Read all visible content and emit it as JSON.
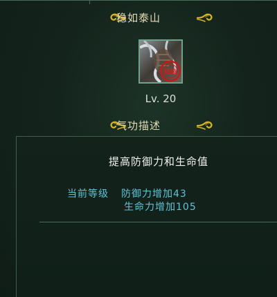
{
  "skill": {
    "name": "稳如泰山",
    "level": "Lv. 20",
    "icon": "skill-stone-armor-icon",
    "stamp_text": "顶级"
  },
  "description_header": "气功描述",
  "description": {
    "main": "提高防御力和生命值",
    "current_level_label": "当前等级",
    "bonuses": [
      "防御力增加43",
      "生命力增加105"
    ]
  },
  "colors": {
    "title": "#e4dbb5",
    "ornament": "#d8b62a",
    "bonus_text": "#5fc4d8",
    "body_text": "#f2f2f2",
    "border": "#4a6c57"
  }
}
